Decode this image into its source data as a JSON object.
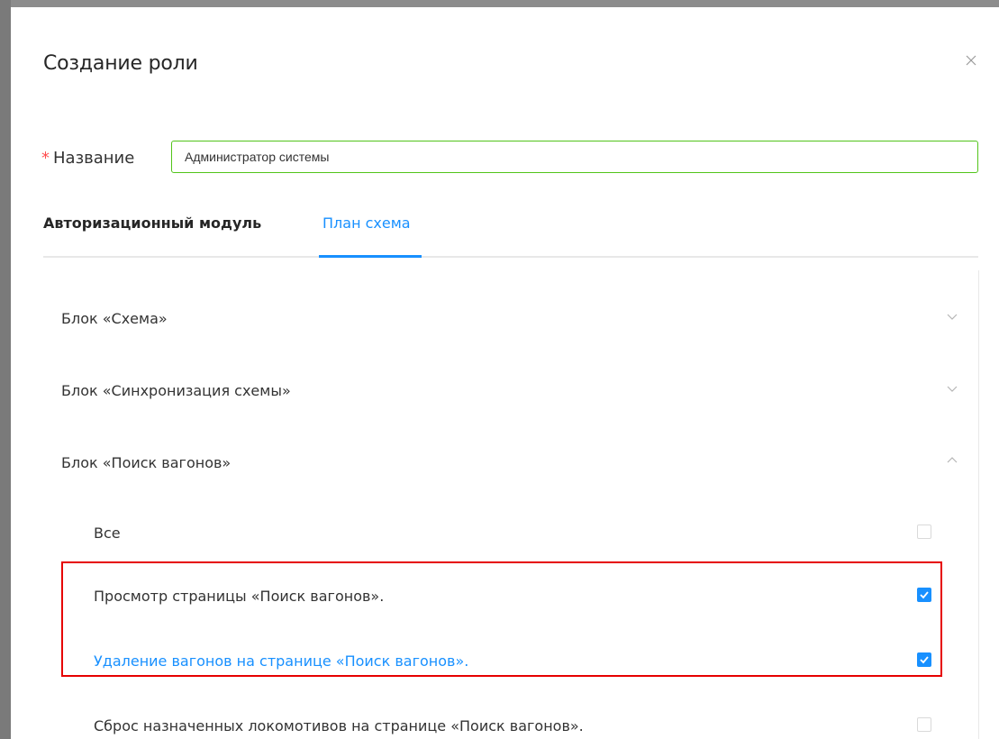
{
  "modal": {
    "title": "Создание роли",
    "close_icon": "close-icon"
  },
  "form": {
    "name_label": "Название",
    "required_mark": "*",
    "name_value": "Администратор системы"
  },
  "tabs": [
    {
      "label": "Авторизационный модуль",
      "active": false
    },
    {
      "label": "План схема",
      "active": true
    }
  ],
  "blocks": [
    {
      "title": "Блок «Схема»",
      "expanded": false,
      "icon": "chevron-down-icon"
    },
    {
      "title": "Блок «Синхронизация схемы»",
      "expanded": false,
      "icon": "chevron-down-icon"
    },
    {
      "title": "Блок «Поиск вагонов»",
      "expanded": true,
      "icon": "chevron-up-icon"
    }
  ],
  "permissions": [
    {
      "label": "Все",
      "checked": false
    },
    {
      "label": "Просмотр страницы «Поиск вагонов».",
      "checked": true
    },
    {
      "label": "Удаление вагонов на странице «Поиск вагонов».",
      "checked": true
    },
    {
      "label": "Сброс назначенных локомотивов на странице «Поиск вагонов».",
      "checked": false
    }
  ],
  "colors": {
    "accent": "#1890ff",
    "required": "#ff4d4f",
    "input_border_valid": "#52c41a",
    "highlight_box": "#e60000"
  }
}
